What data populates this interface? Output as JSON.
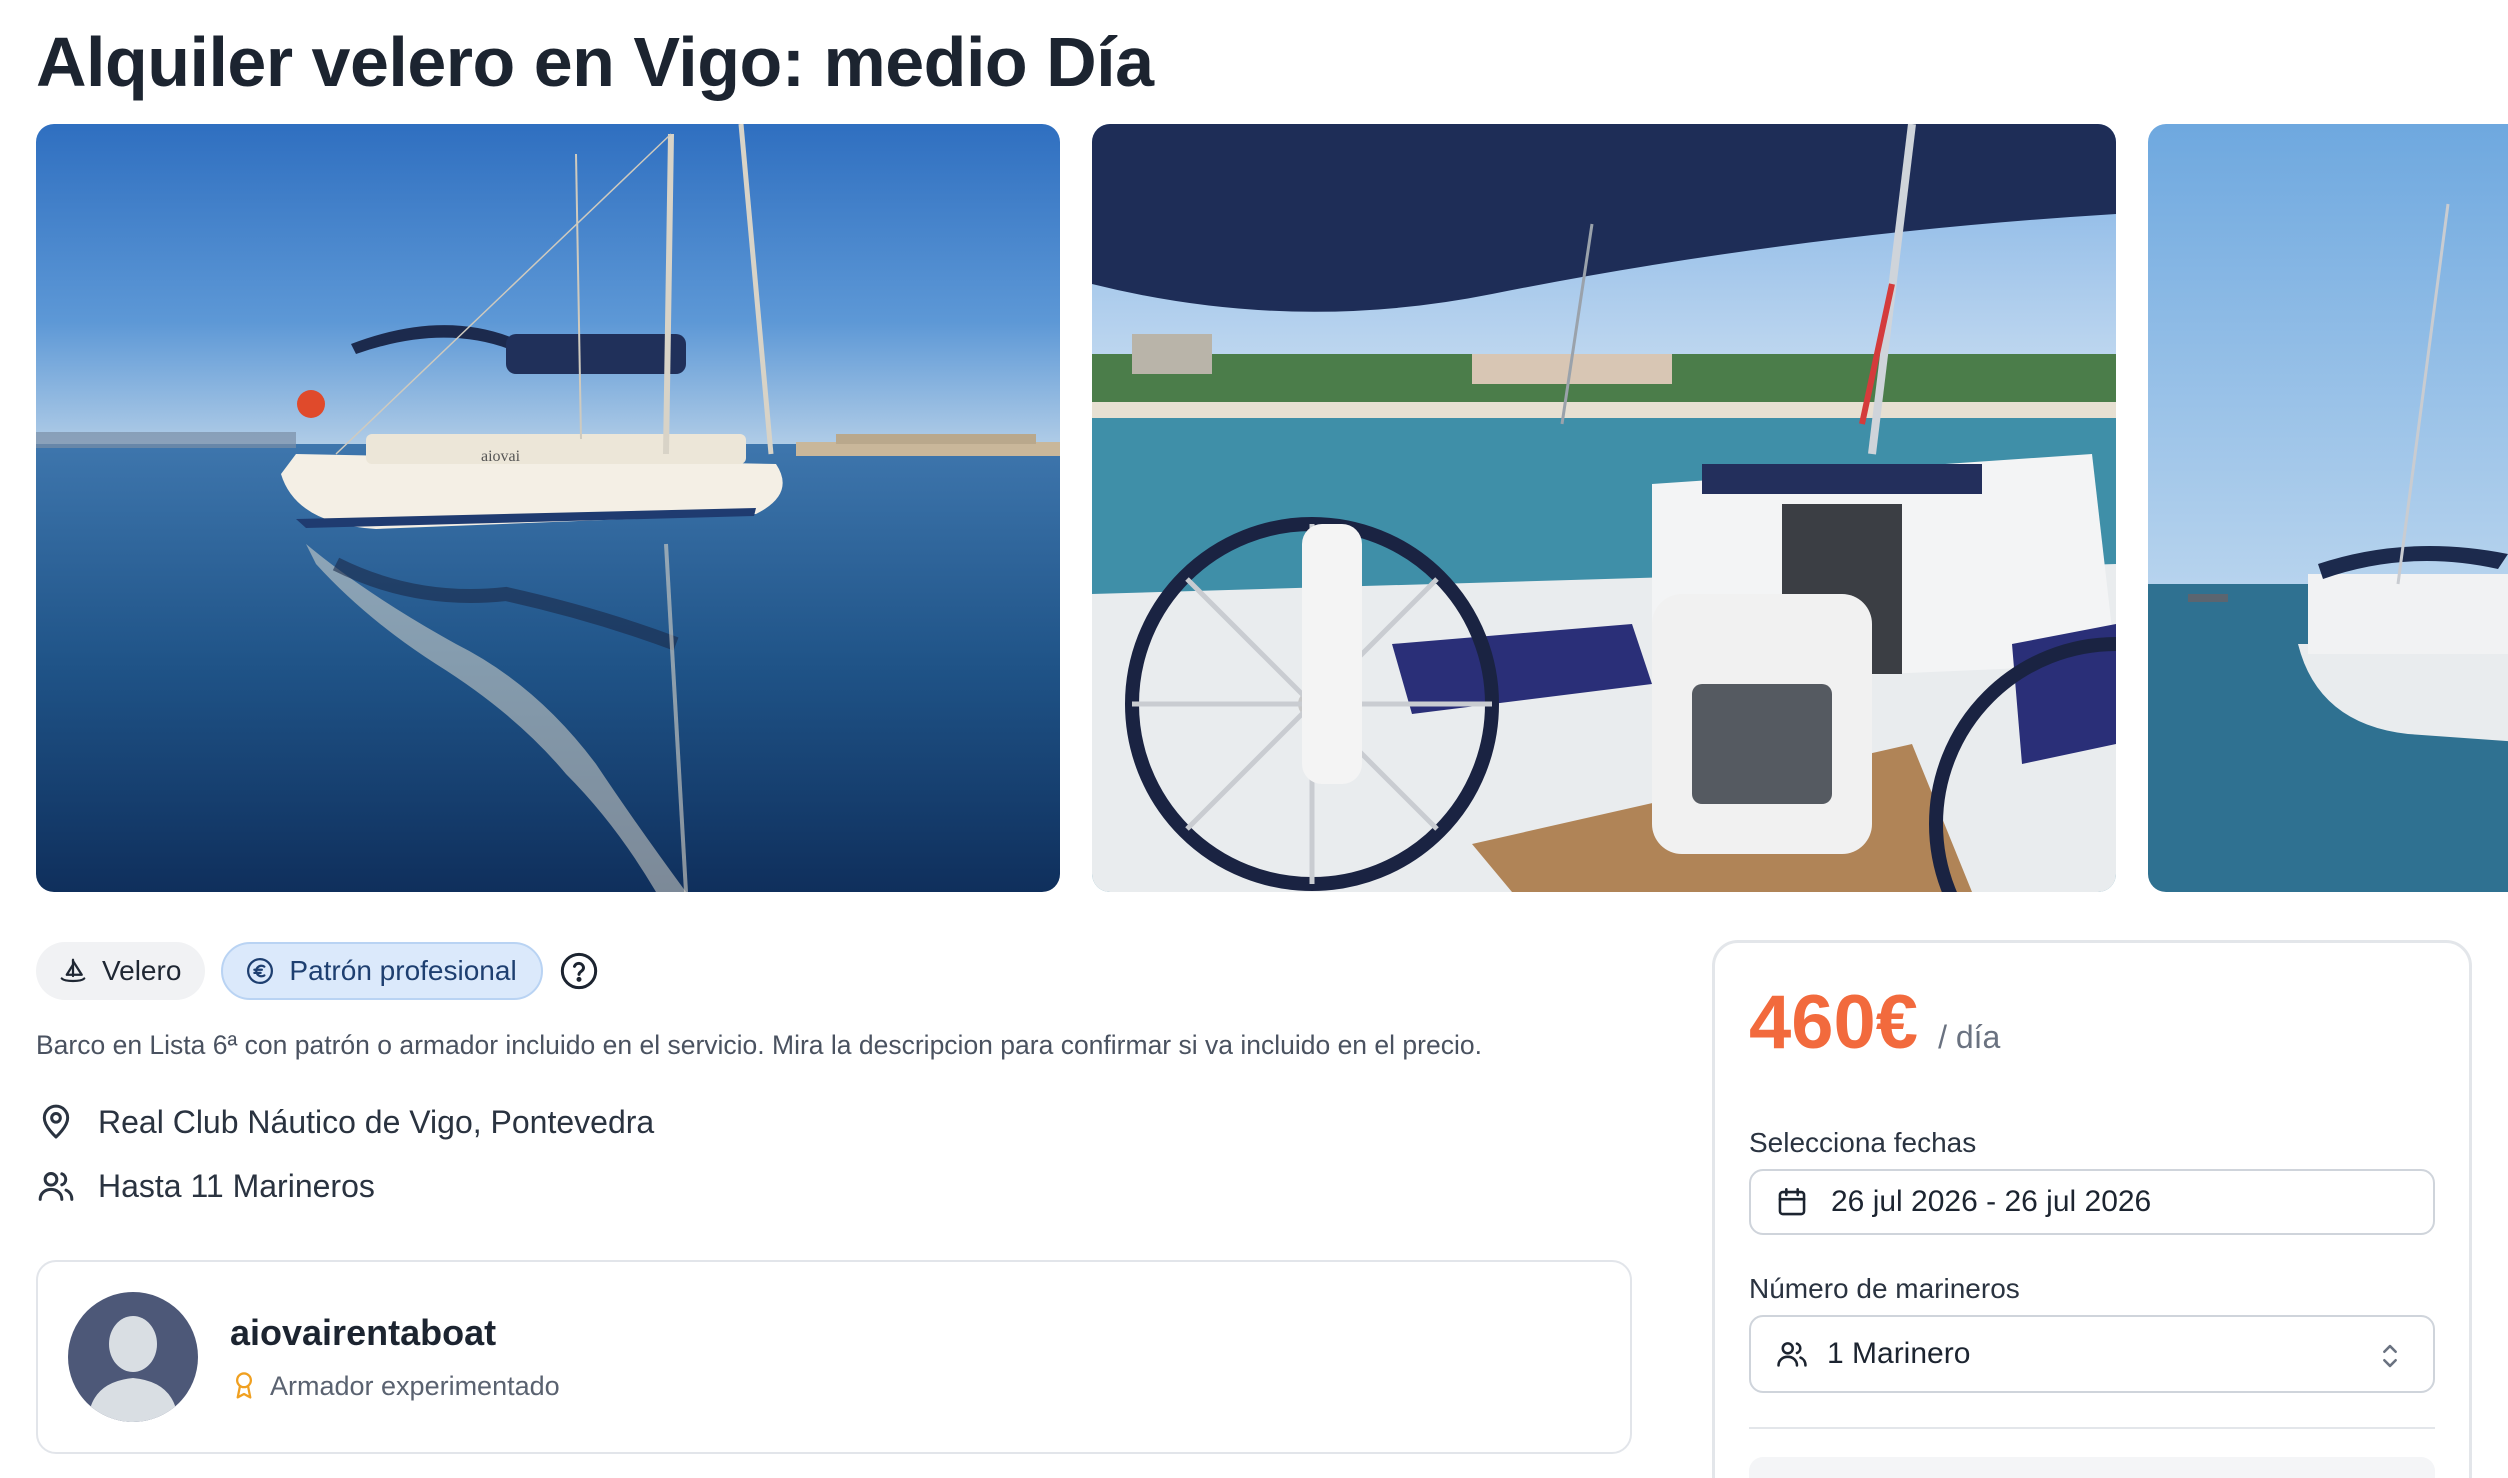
{
  "listing": {
    "title": "Alquiler velero en Vigo: medio Día",
    "photos": [
      {
        "alt": "boat-at-sea-photo",
        "boat_name": "aiovai"
      },
      {
        "alt": "cockpit-wheel-photo"
      },
      {
        "alt": "boat-side-photo"
      }
    ],
    "tags": {
      "boat_type": "Velero",
      "boat_type_icon": "sailboat-icon",
      "skipper": "Patrón profesional",
      "skipper_icon": "euro-circle-icon",
      "help_icon": "question-circle-icon"
    },
    "description": "Barco en Lista 6ª con patrón o armador incluido en el servicio. Mira la descripcion para confirmar si va incluido en el precio.",
    "location": "Real Club Náutico de Vigo, Pontevedra",
    "capacity": "Hasta 11 Marineros"
  },
  "owner": {
    "username": "aiovairentaboat",
    "badge": "Armador experimentado",
    "badge_icon": "award-ribbon-icon"
  },
  "booking": {
    "price": "460€",
    "price_unit": "/ día",
    "dates_label": "Selecciona fechas",
    "dates_value": "26 jul 2026 - 26 jul 2026",
    "sailors_label": "Número de marineros",
    "sailors_value": "1 Marinero"
  },
  "colors": {
    "price": "#f26a3d",
    "skipper_chip_bg": "#dbe9fb",
    "text_primary": "#1c2430"
  }
}
